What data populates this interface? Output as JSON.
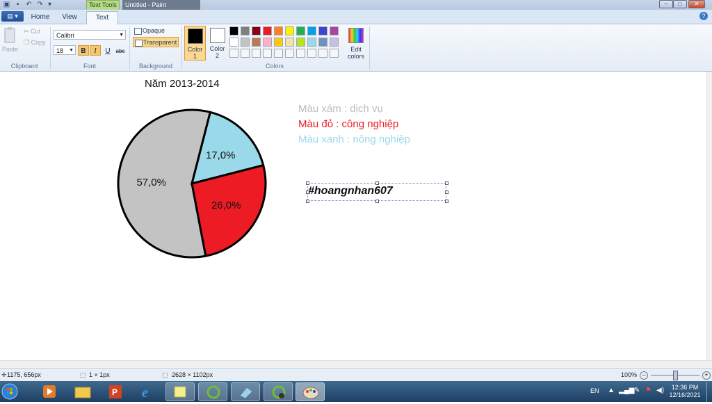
{
  "window": {
    "title": "Untitled - Paint",
    "context_tab": "Text Tools"
  },
  "tabs": {
    "home": "Home",
    "view": "View",
    "text": "Text"
  },
  "ribbon": {
    "clipboard": {
      "paste": "Paste",
      "cut": "Cut",
      "copy": "Copy",
      "label": "Clipboard"
    },
    "font": {
      "name": "Calibri",
      "size": "18",
      "bold": "B",
      "italic": "I",
      "underline": "U",
      "strike": "abc",
      "label": "Font"
    },
    "background": {
      "opaque": "Opaque",
      "transparent": "Transparent",
      "label": "Background"
    },
    "colors": {
      "color1": "Color 1",
      "color2": "Color 2",
      "edit": "Edit colors",
      "label": "Colors",
      "color1_value": "#000000",
      "color2_value": "#ffffff",
      "palette_row1": [
        "#000000",
        "#7f7f7f",
        "#880015",
        "#ed1c24",
        "#ff7f27",
        "#fff200",
        "#22b14c",
        "#00a2e8",
        "#3f48cc",
        "#a349a4"
      ],
      "palette_row2": [
        "#ffffff",
        "#c3c3c3",
        "#b97a57",
        "#ffaec9",
        "#ffc90e",
        "#efe4b0",
        "#b5e61d",
        "#99d9ea",
        "#7092be",
        "#c8bfe7"
      ]
    }
  },
  "canvas": {
    "chart_title": "Năm 2013-2014",
    "legend": [
      {
        "text": "Màu xám : dịch vụ",
        "color": "#bcbcbc"
      },
      {
        "text": "Màu đỏ : công nghiệp",
        "color": "#ec1c24"
      },
      {
        "text": "Màu xanh : nông nghiệp",
        "color": "#99d9ea"
      }
    ],
    "text_box": "#hoangnhan607"
  },
  "chart_data": {
    "type": "pie",
    "title": "Năm 2013-2014",
    "slices": [
      {
        "label": "57,0%",
        "value": 57.0,
        "color": "#c3c3c3"
      },
      {
        "label": "17,0%",
        "value": 17.0,
        "color": "#99d9ea"
      },
      {
        "label": "26,0%",
        "value": 26.0,
        "color": "#ed1c24"
      }
    ]
  },
  "statusbar": {
    "cursor": "1175, 656px",
    "selection": "1 × 1px",
    "size": "2628 × 1102px",
    "zoom": "100%"
  },
  "taskbar": {
    "lang": "EN",
    "time": "12:36 PM",
    "date": "12/16/2021"
  }
}
